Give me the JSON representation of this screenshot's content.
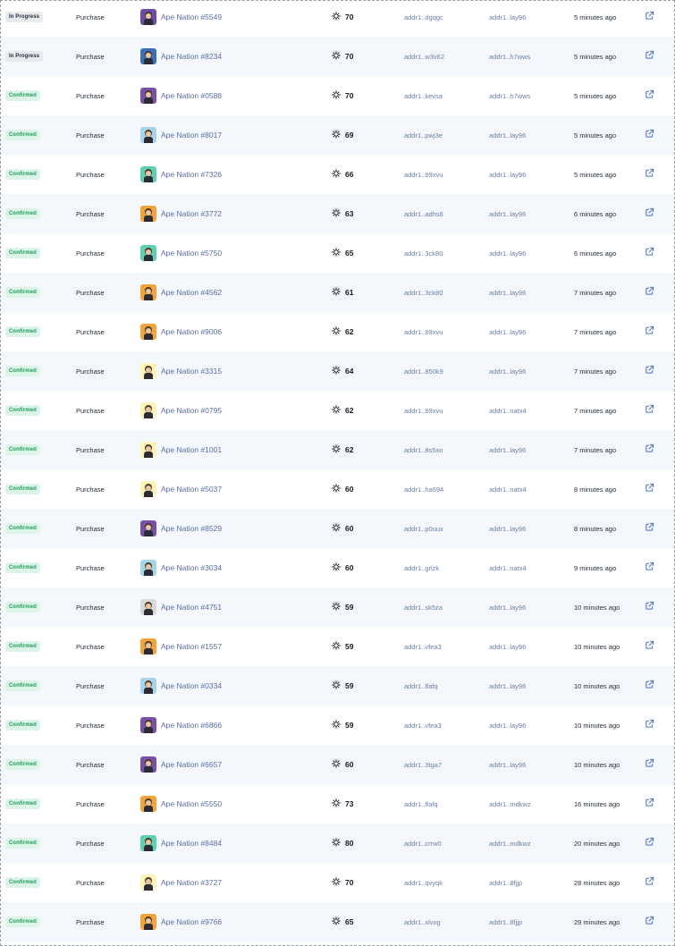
{
  "table": {
    "rows": [
      {
        "status": "In Progress",
        "type": "Purchase",
        "asset": "Ape Nation #5549",
        "bg": "#6e4aa8",
        "rank": "70",
        "from": "addr1..dgqgc",
        "to": "addr1..lay96",
        "time": "5 minutes ago"
      },
      {
        "status": "In Progress",
        "type": "Purchase",
        "asset": "Ape Nation #8234",
        "bg": "#3d6fb6",
        "rank": "70",
        "from": "addr1..w3v62",
        "to": "addr1..h7wws",
        "time": "5 minutes ago"
      },
      {
        "status": "Confirmed",
        "type": "Purchase",
        "asset": "Ape Nation #0588",
        "bg": "#7a4fa8",
        "rank": "70",
        "from": "addr1..kevsa",
        "to": "addr1..h7wws",
        "time": "5 minutes ago"
      },
      {
        "status": "Confirmed",
        "type": "Purchase",
        "asset": "Ape Nation #8017",
        "bg": "#a6d4ea",
        "rank": "69",
        "from": "addr1..pwj3e",
        "to": "addr1..lay96",
        "time": "5 minutes ago"
      },
      {
        "status": "Confirmed",
        "type": "Purchase",
        "asset": "Ape Nation #7326",
        "bg": "#5fd1b0",
        "rank": "66",
        "from": "addr1..99xvu",
        "to": "addr1..lay96",
        "time": "5 minutes ago"
      },
      {
        "status": "Confirmed",
        "type": "Purchase",
        "asset": "Ape Nation #3772",
        "bg": "#f3a33a",
        "rank": "63",
        "from": "addr1..adhs6",
        "to": "addr1..lay96",
        "time": "6 minutes ago"
      },
      {
        "status": "Confirmed",
        "type": "Purchase",
        "asset": "Ape Nation #5750",
        "bg": "#5fd1b0",
        "rank": "65",
        "from": "addr1..3ck80",
        "to": "addr1..lay96",
        "time": "6 minutes ago"
      },
      {
        "status": "Confirmed",
        "type": "Purchase",
        "asset": "Ape Nation #4562",
        "bg": "#f3a33a",
        "rank": "61",
        "from": "addr1..3ck80",
        "to": "addr1..lay96",
        "time": "7 minutes ago"
      },
      {
        "status": "Confirmed",
        "type": "Purchase",
        "asset": "Ape Nation #9006",
        "bg": "#f3a33a",
        "rank": "62",
        "from": "addr1..99xvu",
        "to": "addr1..lay96",
        "time": "7 minutes ago"
      },
      {
        "status": "Confirmed",
        "type": "Purchase",
        "asset": "Ape Nation #3315",
        "bg": "#fff4b8",
        "rank": "64",
        "from": "addr1..850k9",
        "to": "addr1..lay96",
        "time": "7 minutes ago"
      },
      {
        "status": "Confirmed",
        "type": "Purchase",
        "asset": "Ape Nation #0795",
        "bg": "#fff4b8",
        "rank": "62",
        "from": "addr1..99xvu",
        "to": "addr1..natx4",
        "time": "7 minutes ago"
      },
      {
        "status": "Confirmed",
        "type": "Purchase",
        "asset": "Ape Nation #1001",
        "bg": "#fff4b8",
        "rank": "62",
        "from": "addr1..8s5xn",
        "to": "addr1..lay96",
        "time": "7 minutes ago"
      },
      {
        "status": "Confirmed",
        "type": "Purchase",
        "asset": "Ape Nation #5037",
        "bg": "#fff4b8",
        "rank": "60",
        "from": "addr1..ha694",
        "to": "addr1..natx4",
        "time": "8 minutes ago"
      },
      {
        "status": "Confirmed",
        "type": "Purchase",
        "asset": "Ape Nation #8529",
        "bg": "#7a4fa8",
        "rank": "60",
        "from": "addr1..p0uux",
        "to": "addr1..lay96",
        "time": "8 minutes ago"
      },
      {
        "status": "Confirmed",
        "type": "Purchase",
        "asset": "Ape Nation #3034",
        "bg": "#a6d4ea",
        "rank": "60",
        "from": "addr1..grlzk",
        "to": "addr1..natx4",
        "time": "9 minutes ago"
      },
      {
        "status": "Confirmed",
        "type": "Purchase",
        "asset": "Ape Nation #4751",
        "bg": "#d9d9d9",
        "rank": "59",
        "from": "addr1..sk5za",
        "to": "addr1..lay96",
        "time": "10 minutes ago"
      },
      {
        "status": "Confirmed",
        "type": "Purchase",
        "asset": "Ape Nation #1557",
        "bg": "#f3a33a",
        "rank": "59",
        "from": "addr1..vfea3",
        "to": "addr1..lay96",
        "time": "10 minutes ago"
      },
      {
        "status": "Confirmed",
        "type": "Purchase",
        "asset": "Ape Nation #0334",
        "bg": "#a6d4ea",
        "rank": "59",
        "from": "addr1..lfafq",
        "to": "addr1..lay96",
        "time": "10 minutes ago"
      },
      {
        "status": "Confirmed",
        "type": "Purchase",
        "asset": "Ape Nation #6866",
        "bg": "#7a4fa8",
        "rank": "59",
        "from": "addr1..vfea3",
        "to": "addr1..lay96",
        "time": "10 minutes ago"
      },
      {
        "status": "Confirmed",
        "type": "Purchase",
        "asset": "Ape Nation #6657",
        "bg": "#7a4fa8",
        "rank": "60",
        "from": "addr1..3tga7",
        "to": "addr1..lay96",
        "time": "10 minutes ago"
      },
      {
        "status": "Confirmed",
        "type": "Purchase",
        "asset": "Ape Nation #5550",
        "bg": "#f3a33a",
        "rank": "73",
        "from": "addr1..lfafq",
        "to": "addr1..mdkwz",
        "time": "16 minutes ago"
      },
      {
        "status": "Confirmed",
        "type": "Purchase",
        "asset": "Ape Nation #8484",
        "bg": "#5fd1b0",
        "rank": "80",
        "from": "addr1..crrw0",
        "to": "addr1..mdkwz",
        "time": "20 minutes ago"
      },
      {
        "status": "Confirmed",
        "type": "Purchase",
        "asset": "Ape Nation #3727",
        "bg": "#fff4b8",
        "rank": "70",
        "from": "addr1..qvyqk",
        "to": "addr1..8fjjp",
        "time": "28 minutes ago"
      },
      {
        "status": "Confirmed",
        "type": "Purchase",
        "asset": "Ape Nation #9766",
        "bg": "#f3a33a",
        "rank": "65",
        "from": "addr1..xlvxg",
        "to": "addr1..8fjjp",
        "time": "29 minutes ago"
      }
    ]
  },
  "icons": {
    "rank": "rarity-icon",
    "link": "external-link-icon"
  }
}
